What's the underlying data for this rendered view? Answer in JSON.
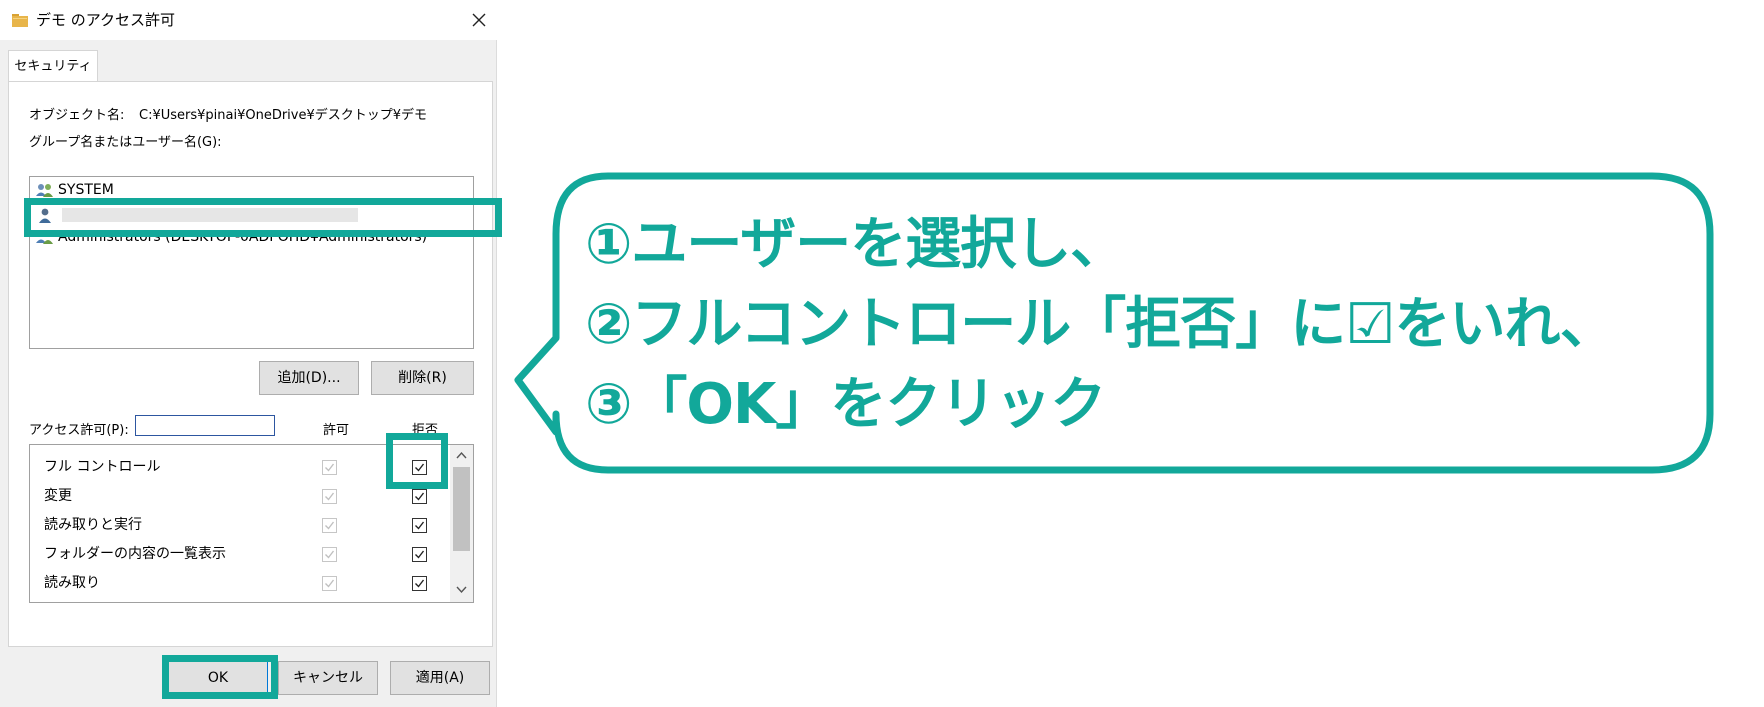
{
  "window": {
    "title": "デモ のアクセス許可",
    "close_icon": "close-icon",
    "folder_icon": "folder-icon",
    "folder_color": "#e8b54a"
  },
  "tabs": [
    {
      "label": "セキュリティ",
      "active": true
    }
  ],
  "object": {
    "label": "オブジェクト名:",
    "value": "C:¥Users¥pinai¥OneDrive¥デスクトップ¥デモ"
  },
  "group_label": "グループ名またはユーザー名(G):",
  "users": [
    {
      "name": "SYSTEM",
      "icon": "group-users-icon"
    },
    {
      "name": "",
      "icon": "user-icon",
      "redacted": true
    },
    {
      "name": "Administrators (DESKTOP-0ADPOHD¥Administrators)",
      "icon": "group-users-icon"
    }
  ],
  "buttons": {
    "add": "追加(D)...",
    "remove": "削除(R)",
    "ok": "OK",
    "cancel": "キャンセル",
    "apply": "適用(A)"
  },
  "permissions": {
    "label": "アクセス許可(P):",
    "col_allow": "許可",
    "col_deny": "拒否",
    "rows": [
      {
        "name": "フル コントロール",
        "allow": true,
        "allow_disabled": true,
        "deny": true
      },
      {
        "name": "変更",
        "allow": true,
        "allow_disabled": true,
        "deny": true
      },
      {
        "name": "読み取りと実行",
        "allow": true,
        "allow_disabled": true,
        "deny": true
      },
      {
        "name": "フォルダーの内容の一覧表示",
        "allow": true,
        "allow_disabled": true,
        "deny": true
      },
      {
        "name": "読み取り",
        "allow": true,
        "allow_disabled": true,
        "deny": true
      }
    ]
  },
  "callout": {
    "line1": "①ユーザーを選択し、",
    "line2": "②フルコントロール「拒否」に☑をいれ、",
    "line3": "③「OK」をクリック",
    "color": "#12a89a"
  }
}
